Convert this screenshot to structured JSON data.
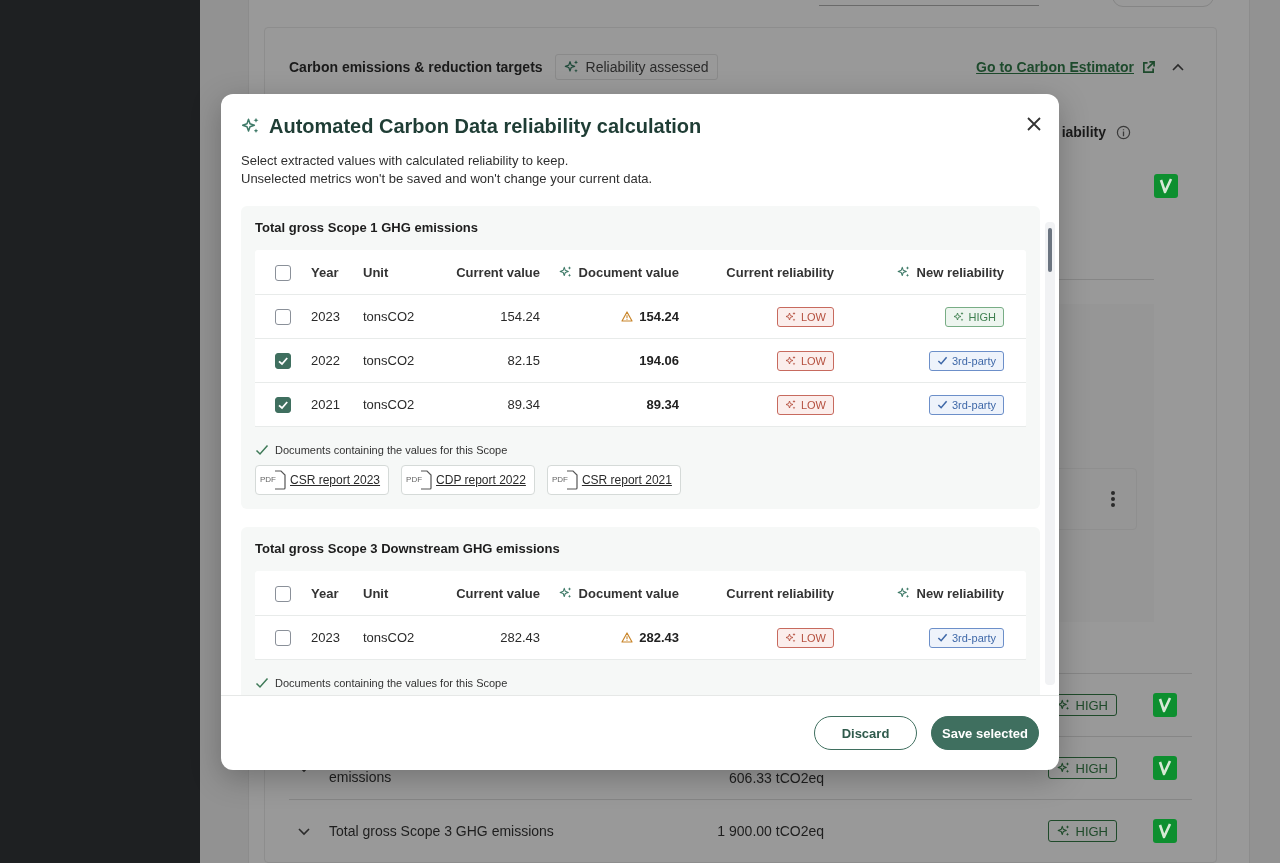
{
  "background": {
    "card_title": "Carbon emissions & reduction targets",
    "badge": "Reliability assessed",
    "link": "Go to Carbon Estimator",
    "reliability_header": "iability",
    "top_row": {
      "verified": true
    },
    "metrics": [
      {
        "reliability": "HIGH",
        "verified": true
      },
      {
        "label": "emissions",
        "value": "606.33 tCO2eq",
        "reliability": "HIGH",
        "verified": true
      },
      {
        "label": "Total gross Scope 3 GHG emissions",
        "value": "1 900.00 tCO2eq",
        "reliability": "HIGH",
        "verified": true
      }
    ]
  },
  "dialog": {
    "title": "Automated Carbon Data reliability calculation",
    "description": [
      "Select extracted values with calculated reliability to keep.",
      "Unselected metrics won't be saved and won't change your current data."
    ],
    "sections": [
      {
        "title": "Total gross Scope 1 GHG emissions",
        "all_selected": false,
        "columns": [
          {
            "label": "Year",
            "ai": false
          },
          {
            "label": "Unit",
            "ai": false
          },
          {
            "label": "Current value",
            "ai": false
          },
          {
            "label": "Document value",
            "ai": true
          },
          {
            "label": "Current reliability",
            "ai": false
          },
          {
            "label": "New reliability",
            "ai": true
          }
        ],
        "rows": [
          {
            "selected": false,
            "year": "2023",
            "unit": "tonsCO2",
            "current_value": "154.24",
            "document_value": "154.24",
            "warning": true,
            "current_reliability": {
              "kind": "low",
              "label": "LOW"
            },
            "new_reliability": {
              "kind": "high",
              "label": "HIGH"
            }
          },
          {
            "selected": true,
            "year": "2022",
            "unit": "tonsCO2",
            "current_value": "82.15",
            "document_value": "194.06",
            "warning": false,
            "current_reliability": {
              "kind": "low",
              "label": "LOW"
            },
            "new_reliability": {
              "kind": "third_party",
              "label": "3rd-party"
            }
          },
          {
            "selected": true,
            "year": "2021",
            "unit": "tonsCO2",
            "current_value": "89.34",
            "document_value": "89.34",
            "warning": false,
            "current_reliability": {
              "kind": "low",
              "label": "LOW"
            },
            "new_reliability": {
              "kind": "third_party",
              "label": "3rd-party"
            }
          }
        ],
        "documents_note": "Documents containing the values for this Scope",
        "documents": [
          {
            "name": "CSR report 2023",
            "file_label": "PDF"
          },
          {
            "name": "CDP report 2022",
            "file_label": "PDF"
          },
          {
            "name": "CSR report 2021",
            "file_label": "PDF"
          }
        ]
      },
      {
        "title": "Total gross Scope 3 Downstream GHG emissions",
        "all_selected": false,
        "columns": [
          {
            "label": "Year",
            "ai": false
          },
          {
            "label": "Unit",
            "ai": false
          },
          {
            "label": "Current value",
            "ai": false
          },
          {
            "label": "Document value",
            "ai": true
          },
          {
            "label": "Current reliability",
            "ai": false
          },
          {
            "label": "New reliability",
            "ai": true
          }
        ],
        "rows": [
          {
            "selected": false,
            "year": "2023",
            "unit": "tonsCO2",
            "current_value": "282.43",
            "document_value": "282.43",
            "warning": true,
            "current_reliability": {
              "kind": "low",
              "label": "LOW"
            },
            "new_reliability": {
              "kind": "third_party",
              "label": "3rd-party"
            }
          }
        ],
        "documents_note": "Documents containing the values for this Scope"
      }
    ],
    "buttons": [
      {
        "label": "Discard",
        "kind": "secondary"
      },
      {
        "label": "Save selected",
        "kind": "primary"
      }
    ]
  }
}
